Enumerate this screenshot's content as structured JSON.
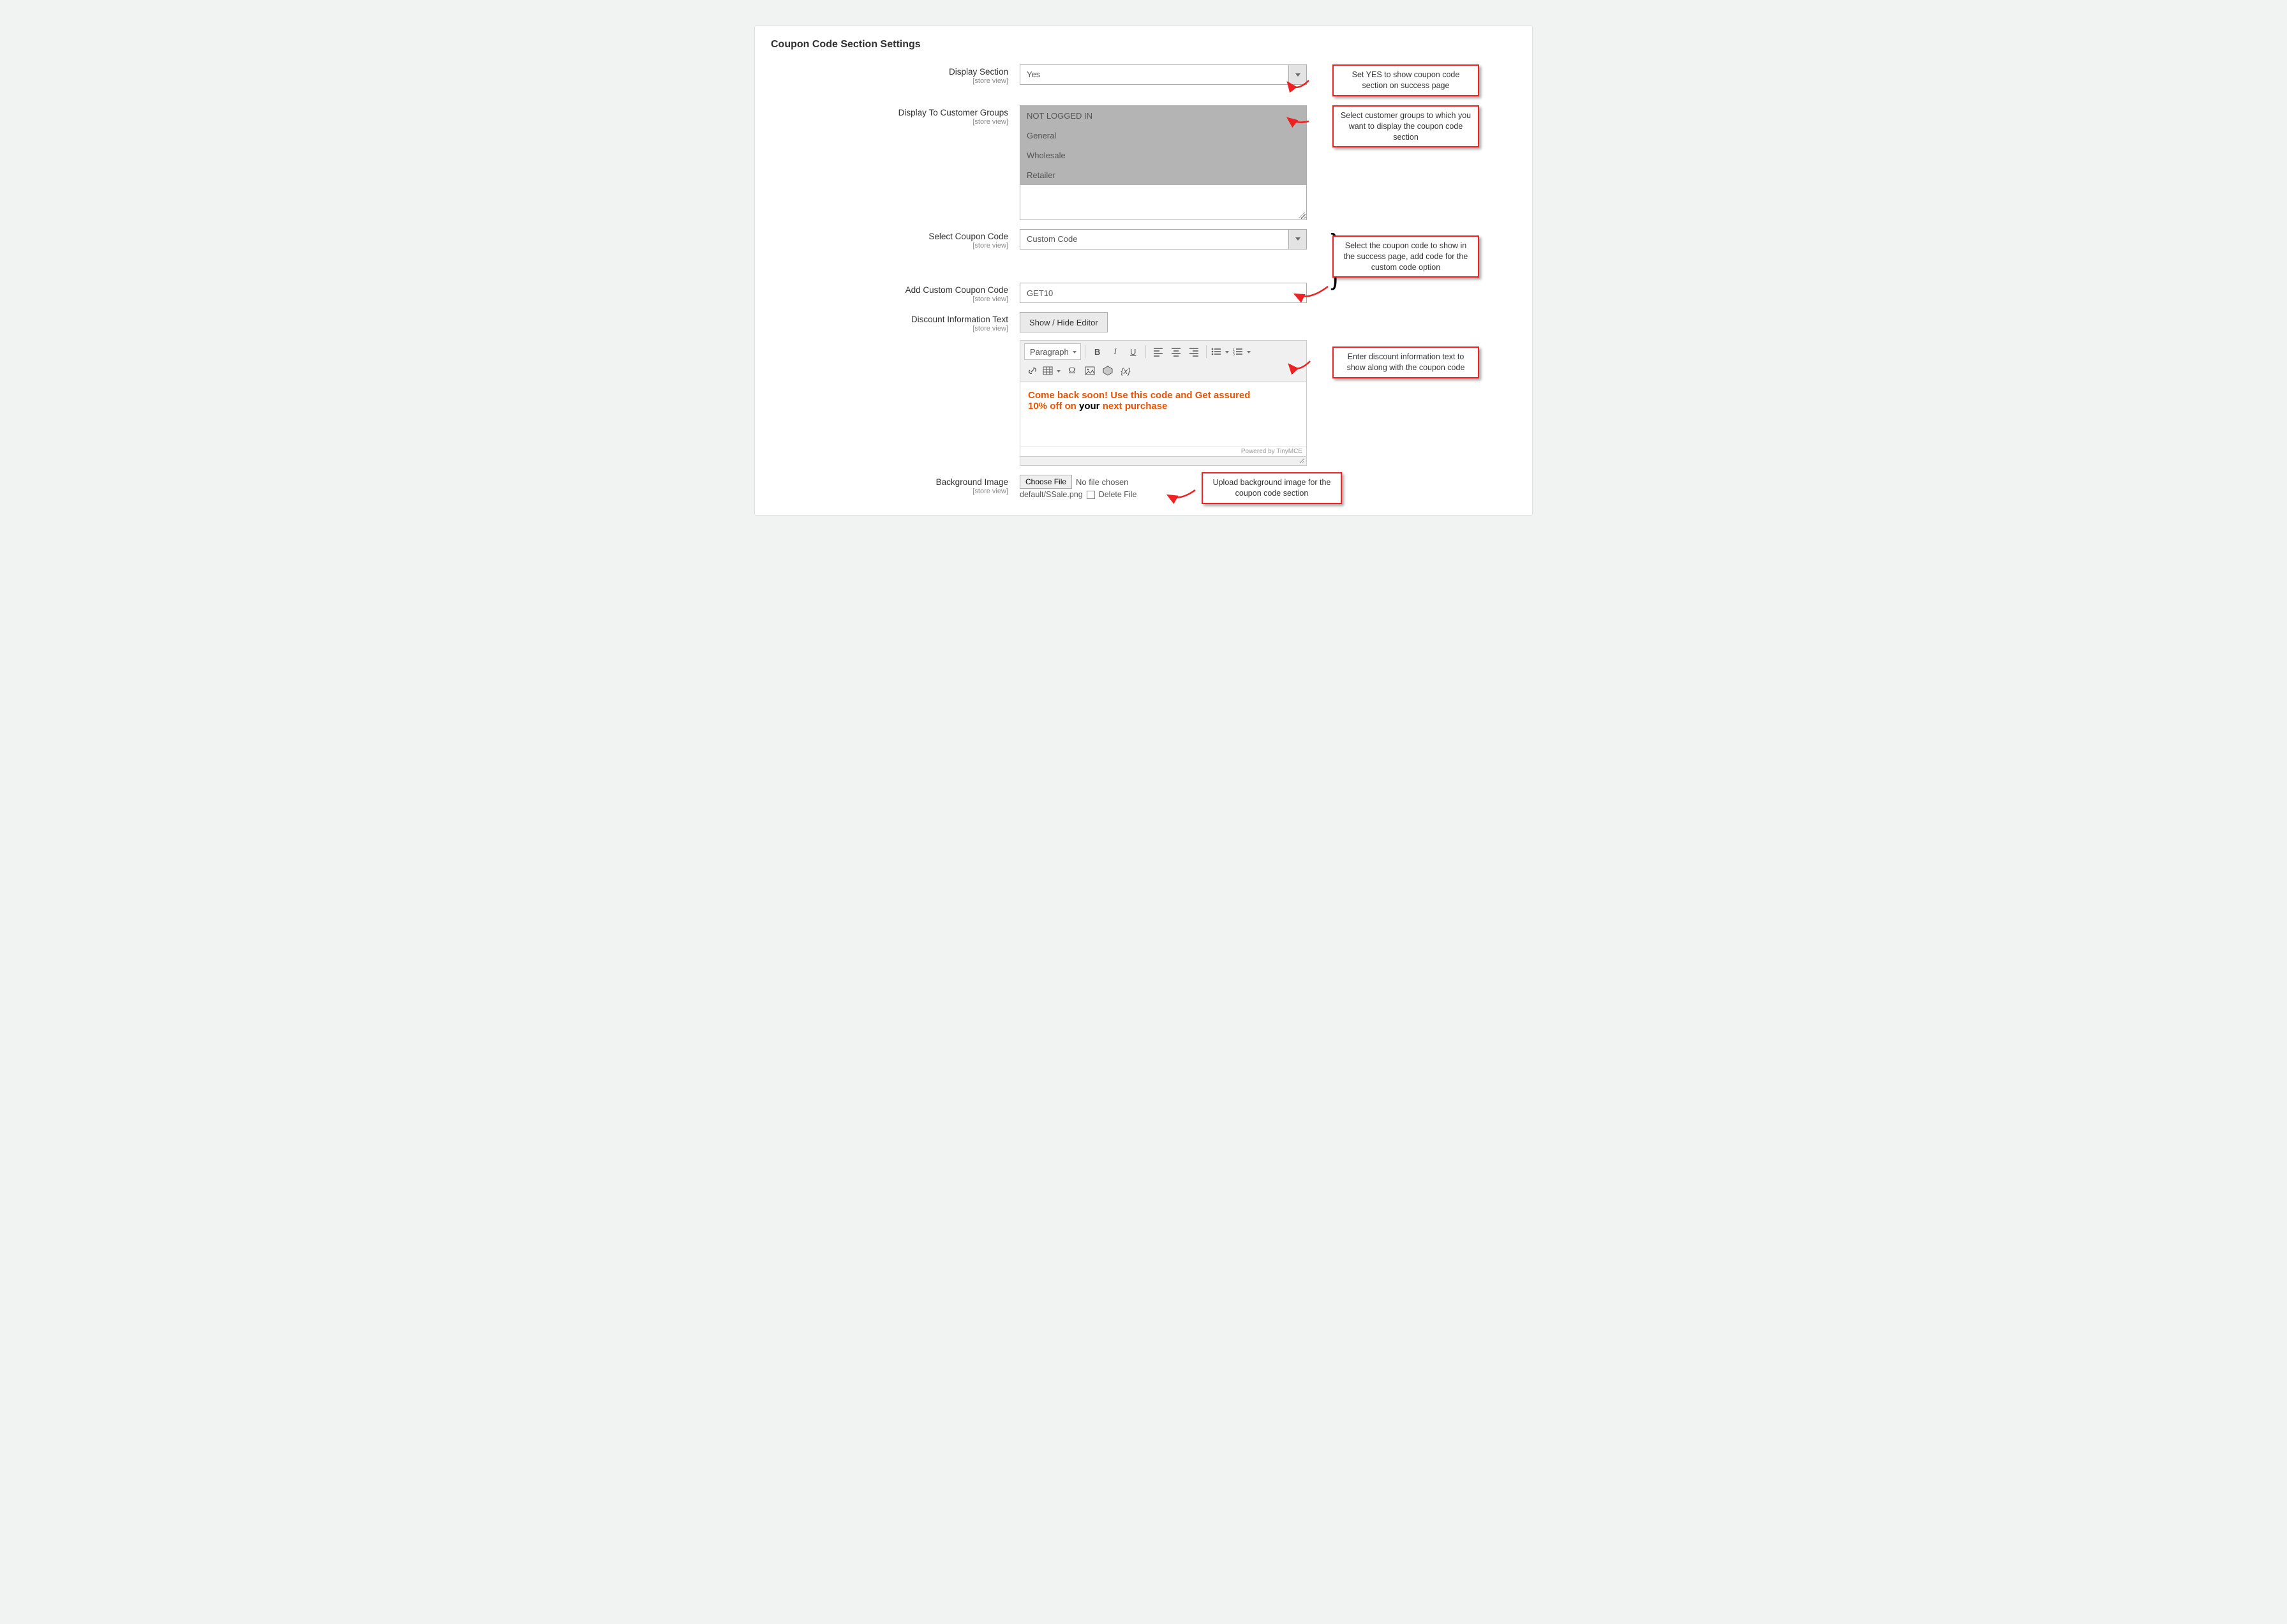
{
  "panel": {
    "title": "Coupon Code Section Settings"
  },
  "scope": "[store view]",
  "fields": {
    "display_section": {
      "label": "Display Section",
      "value": "Yes"
    },
    "display_groups": {
      "label": "Display To Customer Groups",
      "options": [
        "NOT LOGGED IN",
        "General",
        "Wholesale",
        "Retailer"
      ]
    },
    "select_code": {
      "label": "Select Coupon Code",
      "value": "Custom Code"
    },
    "add_custom": {
      "label": "Add Custom Coupon Code",
      "value": "GET10"
    },
    "discount_text": {
      "label": "Discount Information Text",
      "toggle_label": "Show / Hide Editor"
    },
    "bg_image": {
      "label": "Background Image",
      "choose_label": "Choose File",
      "no_file": "No file chosen",
      "current": "default/SSale.png",
      "delete_label": "Delete File"
    }
  },
  "editor": {
    "format_dd": "Paragraph",
    "footer": "Powered by TinyMCE",
    "content": {
      "line1a": "Come back soon! Use this code and Get assured ",
      "line2a": "10% off on ",
      "line2b": "your",
      "line2c": " next purchase"
    }
  },
  "callouts": {
    "c1": "Set YES to show coupon code section on success page",
    "c2": "Select customer groups to which you want to display the coupon code section",
    "c3": "Select the coupon code to show in the success page, add code for the custom code option",
    "c4": "Enter discount information text to show along with the coupon code",
    "c5": "Upload background image for the coupon code section"
  }
}
